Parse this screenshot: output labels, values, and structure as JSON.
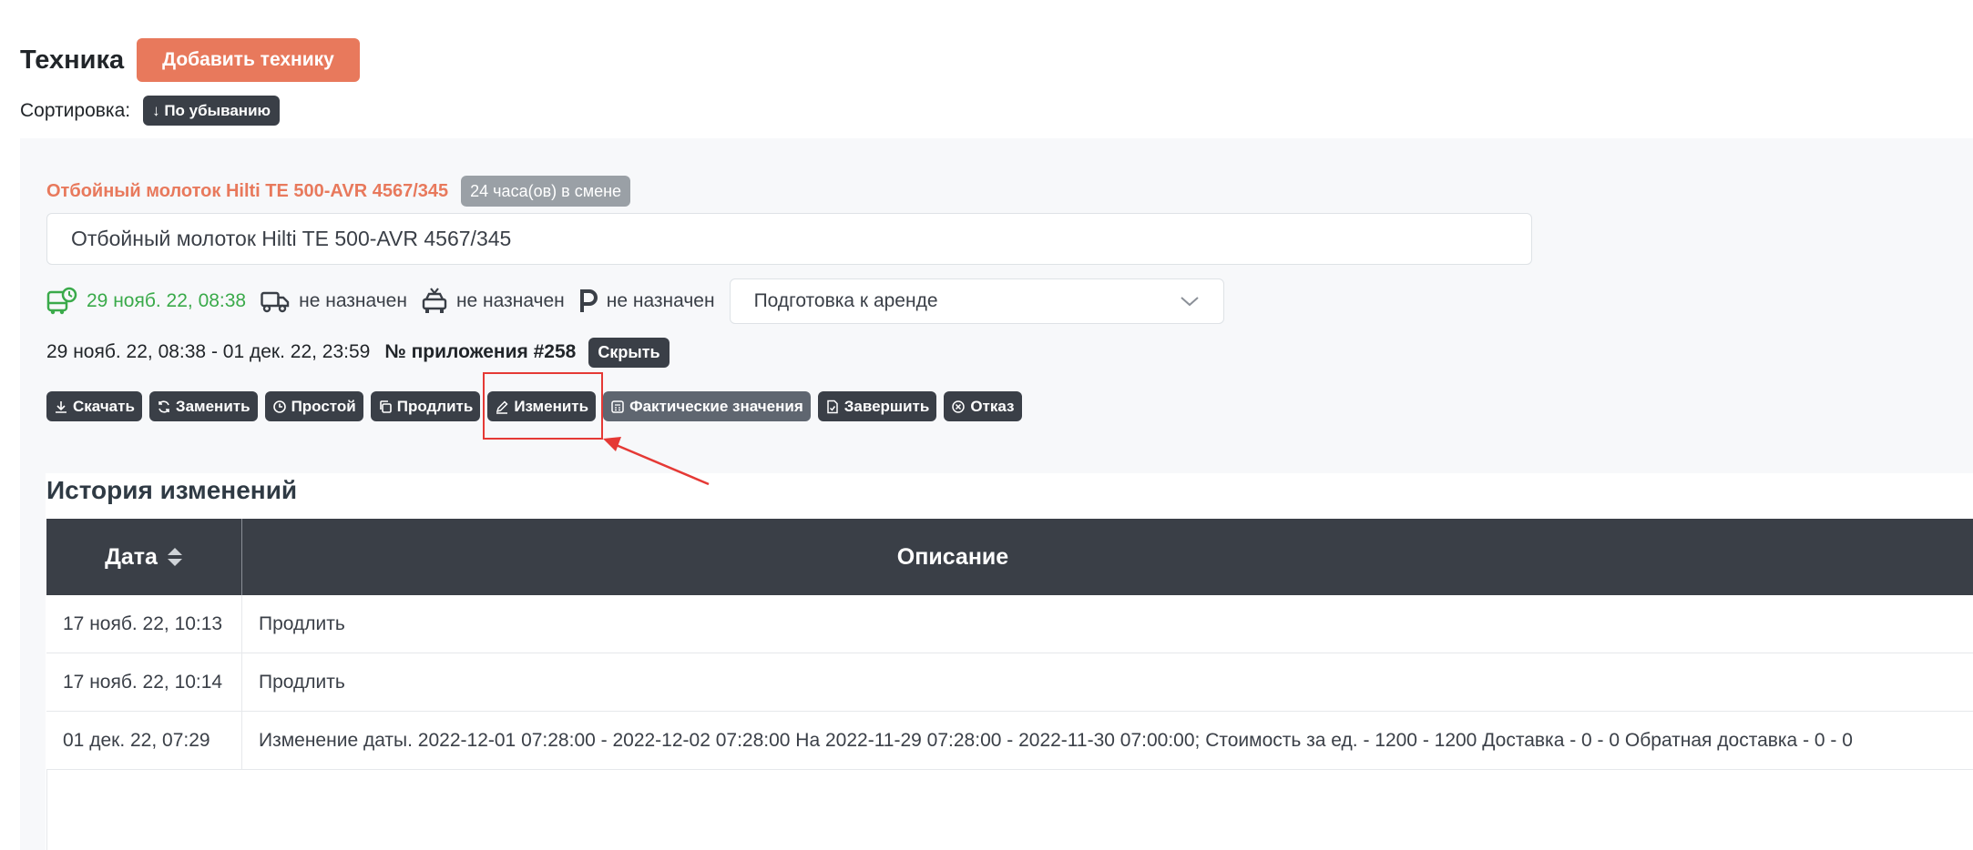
{
  "header": {
    "title": "Техника",
    "add_button": "Добавить технику"
  },
  "sort": {
    "label": "Сортировка:",
    "badge": "↓ По убыванию"
  },
  "item": {
    "title": "Отбойный молоток Hilti TE 500-AVR 4567/345",
    "shift_badge": "24 часа(ов) в смене",
    "name_value": "Отбойный молоток Hilti TE 500-AVR 4567/345",
    "status": {
      "date": "29 нояб. 22, 08:38",
      "truck": "не назначен",
      "driver": "не назначен",
      "parking": "не назначен",
      "select_value": "Подготовка к аренде"
    },
    "period": "29 нояб. 22, 08:38 - 01 дек. 22, 23:59",
    "app_number": "№ приложения #258",
    "hide_label": "Скрыть"
  },
  "actions": [
    {
      "label": "Скачать",
      "icon": "download-icon"
    },
    {
      "label": "Заменить",
      "icon": "refresh-icon"
    },
    {
      "label": "Простой",
      "icon": "clock-icon"
    },
    {
      "label": "Продлить",
      "icon": "copy-icon"
    },
    {
      "label": "Изменить",
      "icon": "pen-icon"
    },
    {
      "label": "Фактические значения",
      "icon": "calculator-icon"
    },
    {
      "label": "Завершить",
      "icon": "file-check-icon"
    },
    {
      "label": "Отказ",
      "icon": "x-circle-icon"
    }
  ],
  "history": {
    "title": "История изменений",
    "columns": [
      "Дата",
      "Описание"
    ],
    "rows": [
      {
        "date": "17 нояб. 22, 10:13",
        "desc": "Продлить"
      },
      {
        "date": "17 нояб. 22, 10:14",
        "desc": "Продлить"
      },
      {
        "date": "01 дек. 22, 07:29",
        "desc": "Изменение даты. 2022-12-01 07:28:00 - 2022-12-02 07:28:00 На 2022-11-29 07:28:00 - 2022-11-30 07:00:00; Стоимость за ед. - 1200 - 1200 Доставка - 0 - 0 Обратная доставка - 0 - 0"
      }
    ]
  },
  "colors": {
    "accent": "#e8795c",
    "dark": "#3a3f47",
    "green": "#3aaa4a",
    "highlight": "#e53935"
  }
}
